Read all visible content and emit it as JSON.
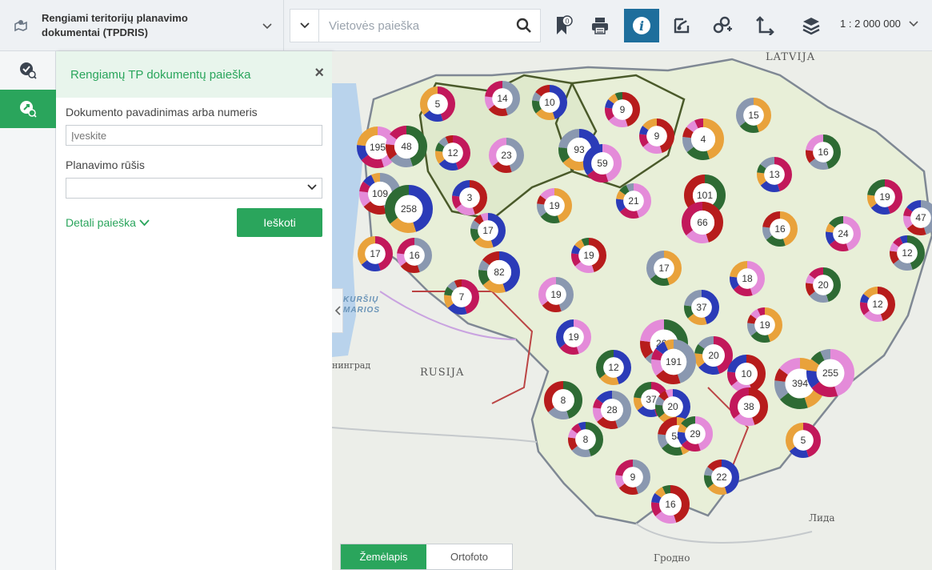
{
  "header": {
    "app_title": "Rengiami teritorijų planavimo dokumentai (TPDRIS)",
    "search_placeholder": "Vietovės paieška",
    "scale": "1 : 2 000 000",
    "bookmark_badge": "0",
    "tools": [
      "bookmark-icon",
      "print-icon",
      "info-icon",
      "measure-icon",
      "route-icon",
      "coordinate-icon",
      "layers-icon"
    ],
    "active_tool": "info-icon"
  },
  "rail": {
    "items": [
      "search-check-icon",
      "search-document-icon"
    ],
    "active": "search-document-icon"
  },
  "panel": {
    "title": "Rengiamų TP dokumentų paieška",
    "close": "×",
    "doc_label": "Dokumento pavadinimas arba numeris",
    "doc_placeholder": "Įveskite",
    "type_label": "Planavimo rūšis",
    "type_value": "",
    "detail_link": "Detali paieška",
    "search_button": "Ieškoti"
  },
  "map": {
    "country_labels": [
      "LATVIJA",
      "RUSIJA"
    ],
    "sea_label": [
      "KURŠIŲ",
      "MARIOS"
    ],
    "place_labels": [
      "нинград",
      "Лида",
      "Гродно"
    ],
    "basemap": [
      "Žemėlapis",
      "Ortofoto"
    ],
    "basemap_active": "Žemėlapis",
    "category_colors": [
      "#c2185b",
      "#8a98b0",
      "#2b3bb8",
      "#b71c1c",
      "#e9a23b",
      "#e48bd9",
      "#2e6b34"
    ],
    "clusters": [
      {
        "count": "5"
      },
      {
        "count": "14"
      },
      {
        "count": "10"
      },
      {
        "count": "9"
      },
      {
        "count": "15"
      },
      {
        "count": "195"
      },
      {
        "count": "48"
      },
      {
        "count": "12"
      },
      {
        "count": "23"
      },
      {
        "count": "93"
      },
      {
        "count": "9"
      },
      {
        "count": "4"
      },
      {
        "count": "59"
      },
      {
        "count": "16"
      },
      {
        "count": "13"
      },
      {
        "count": "109"
      },
      {
        "count": "258"
      },
      {
        "count": "3"
      },
      {
        "count": "19"
      },
      {
        "count": "21"
      },
      {
        "count": "101"
      },
      {
        "count": "19"
      },
      {
        "count": "47"
      },
      {
        "count": "17"
      },
      {
        "count": "66"
      },
      {
        "count": "16"
      },
      {
        "count": "24"
      },
      {
        "count": "12"
      },
      {
        "count": "17"
      },
      {
        "count": "16"
      },
      {
        "count": "82"
      },
      {
        "count": "19"
      },
      {
        "count": "17"
      },
      {
        "count": "18"
      },
      {
        "count": "20"
      },
      {
        "count": "7"
      },
      {
        "count": "19"
      },
      {
        "count": "37"
      },
      {
        "count": "12"
      },
      {
        "count": "19"
      },
      {
        "count": "19"
      },
      {
        "count": "262"
      },
      {
        "count": "20"
      },
      {
        "count": "191"
      },
      {
        "count": "12"
      },
      {
        "count": "10"
      },
      {
        "count": "394"
      },
      {
        "count": "255"
      },
      {
        "count": "8"
      },
      {
        "count": "37"
      },
      {
        "count": "28"
      },
      {
        "count": "20"
      },
      {
        "count": "38"
      },
      {
        "count": "58"
      },
      {
        "count": "29"
      },
      {
        "count": "8"
      },
      {
        "count": "5"
      },
      {
        "count": "9"
      },
      {
        "count": "22"
      },
      {
        "count": "16"
      }
    ]
  }
}
